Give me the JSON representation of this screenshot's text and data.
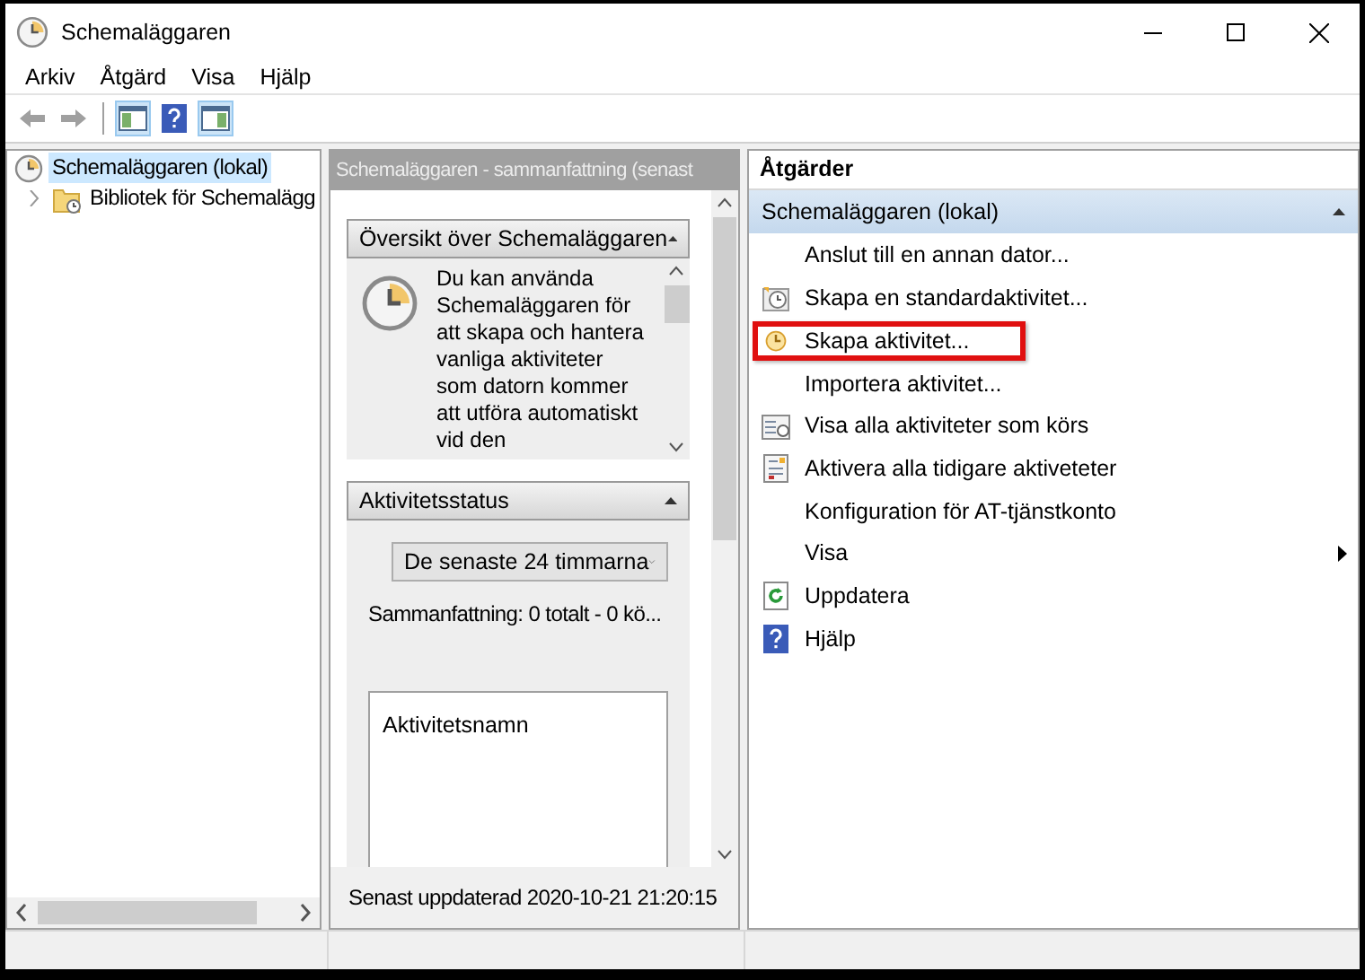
{
  "window": {
    "title": "Schemaläggaren"
  },
  "menu": [
    "Arkiv",
    "Åtgärd",
    "Visa",
    "Hjälp"
  ],
  "toolbar": [
    {
      "kind": "back",
      "disabled": true
    },
    {
      "kind": "forward",
      "disabled": true
    },
    {
      "kind": "tree-pane",
      "selected": true
    },
    {
      "kind": "help"
    },
    {
      "kind": "action-pane",
      "selected": true
    }
  ],
  "tree": {
    "items": [
      {
        "label": "Schemaläggaren (lokal)",
        "selected": true,
        "kind": "clock",
        "children": [
          {
            "label": "Bibliotek för Schemalägg",
            "selected": false,
            "expanded": false,
            "kind": "folder"
          }
        ]
      }
    ]
  },
  "summary": {
    "title": "Schemaläggaren - sammanfattning (senast",
    "overview": {
      "title": "Översikt över Schemaläggaren",
      "expanded": true,
      "text": "Du kan använda Schemaläggaren för att skapa och hantera vanliga aktiviteter som datorn kommer att utföra automatiskt vid den"
    },
    "status": {
      "title": "Aktivitetsstatus",
      "expanded": true,
      "period": "De senaste 24 timmarna",
      "summary": "Sammanfattning: 0 totalt - 0 kö...",
      "list_header": "Aktivitetsnamn"
    },
    "last_updated": "Senast uppdaterad 2020-10-21 21:20:15"
  },
  "actions": {
    "title": "Åtgärder",
    "group": {
      "label": "Schemaläggaren (lokal)",
      "expanded": true
    },
    "items": [
      {
        "label": "Anslut till en annan dator...",
        "kind": "plain",
        "highlighted": false
      },
      {
        "label": "Skapa en standardaktivitet...",
        "kind": "basic-task",
        "highlighted": false
      },
      {
        "label": "Skapa aktivitet...",
        "kind": "task",
        "highlighted": true
      },
      {
        "label": "Importera aktivitet...",
        "kind": "plain",
        "highlighted": false
      },
      {
        "label": "Visa alla aktiviteter som körs",
        "kind": "running",
        "highlighted": false
      },
      {
        "label": "Aktivera alla tidigare aktiveteter",
        "kind": "history",
        "highlighted": false
      },
      {
        "label": "Konfiguration för AT-tjänstkonto",
        "kind": "plain",
        "highlighted": false
      },
      {
        "label": "Visa",
        "kind": "submenu",
        "highlighted": false
      },
      {
        "label": "Uppdatera",
        "kind": "refresh",
        "highlighted": false
      },
      {
        "label": "Hjälp",
        "kind": "help",
        "highlighted": false
      }
    ]
  }
}
